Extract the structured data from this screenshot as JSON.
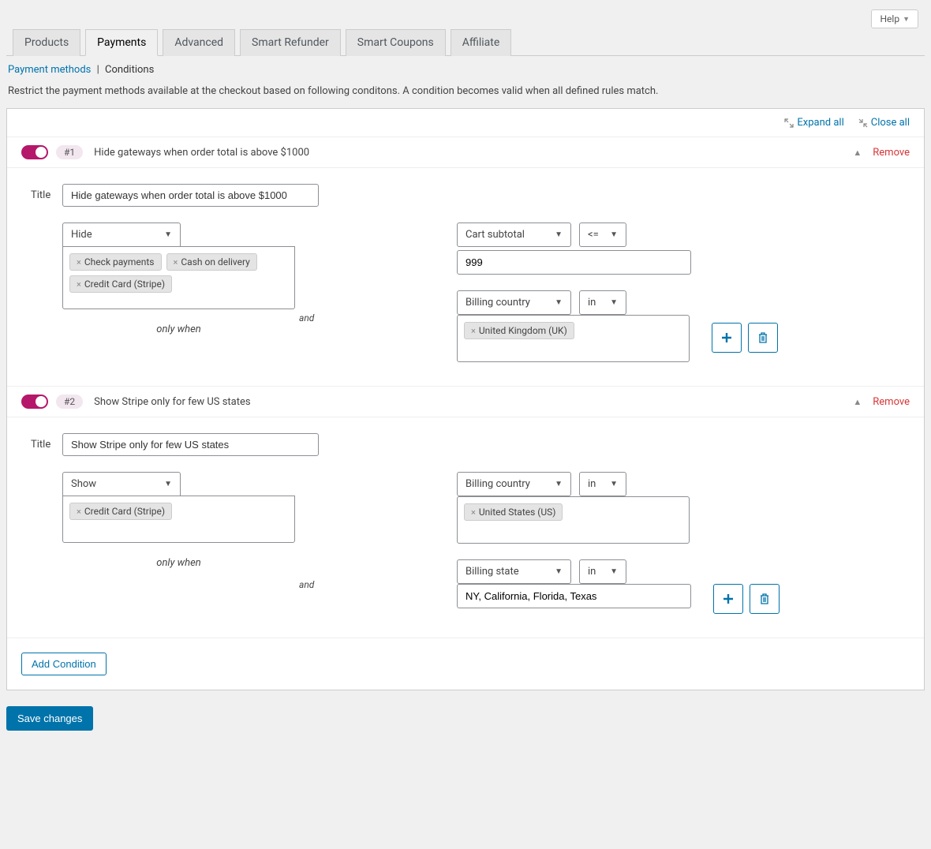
{
  "help_label": "Help",
  "tabs": [
    "Products",
    "Payments",
    "Advanced",
    "Smart Refunder",
    "Smart Coupons",
    "Affiliate"
  ],
  "active_tab_index": 1,
  "sublinks": {
    "payment_methods": "Payment methods",
    "conditions": "Conditions"
  },
  "description": "Restrict the payment methods available at the checkout based on following conditons. A condition becomes valid when all defined rules match.",
  "panel_actions": {
    "expand_all": "Expand all",
    "close_all": "Close all"
  },
  "title_label": "Title",
  "only_when_label": "only when",
  "and_label": "and",
  "add_condition_label": "Add Condition",
  "save_label": "Save changes",
  "remove_label": "Remove",
  "conditions": [
    {
      "badge": "#1",
      "name": "Hide gateways when order total is above $1000",
      "title_value": "Hide gateways when order total is above $1000",
      "action": "Hide",
      "gateways": [
        "Check payments",
        "Cash on delivery",
        "Credit Card (Stripe)"
      ],
      "rules": [
        {
          "field": "Cart subtotal",
          "operator": "<=",
          "value": "999",
          "value_type": "text"
        },
        {
          "connector": "and",
          "field": "Billing country",
          "operator": "in",
          "value_type": "chips",
          "chips": [
            "United Kingdom (UK)"
          ]
        }
      ]
    },
    {
      "badge": "#2",
      "name": "Show Stripe only for few US states",
      "title_value": "Show Stripe only for few US states",
      "action": "Show",
      "gateways": [
        "Credit Card (Stripe)"
      ],
      "rules": [
        {
          "field": "Billing country",
          "operator": "in",
          "value_type": "chips",
          "chips": [
            "United States (US)"
          ]
        },
        {
          "connector": "and",
          "field": "Billing state",
          "operator": "in",
          "value_type": "text",
          "value": "NY, California, Florida, Texas"
        }
      ]
    }
  ]
}
